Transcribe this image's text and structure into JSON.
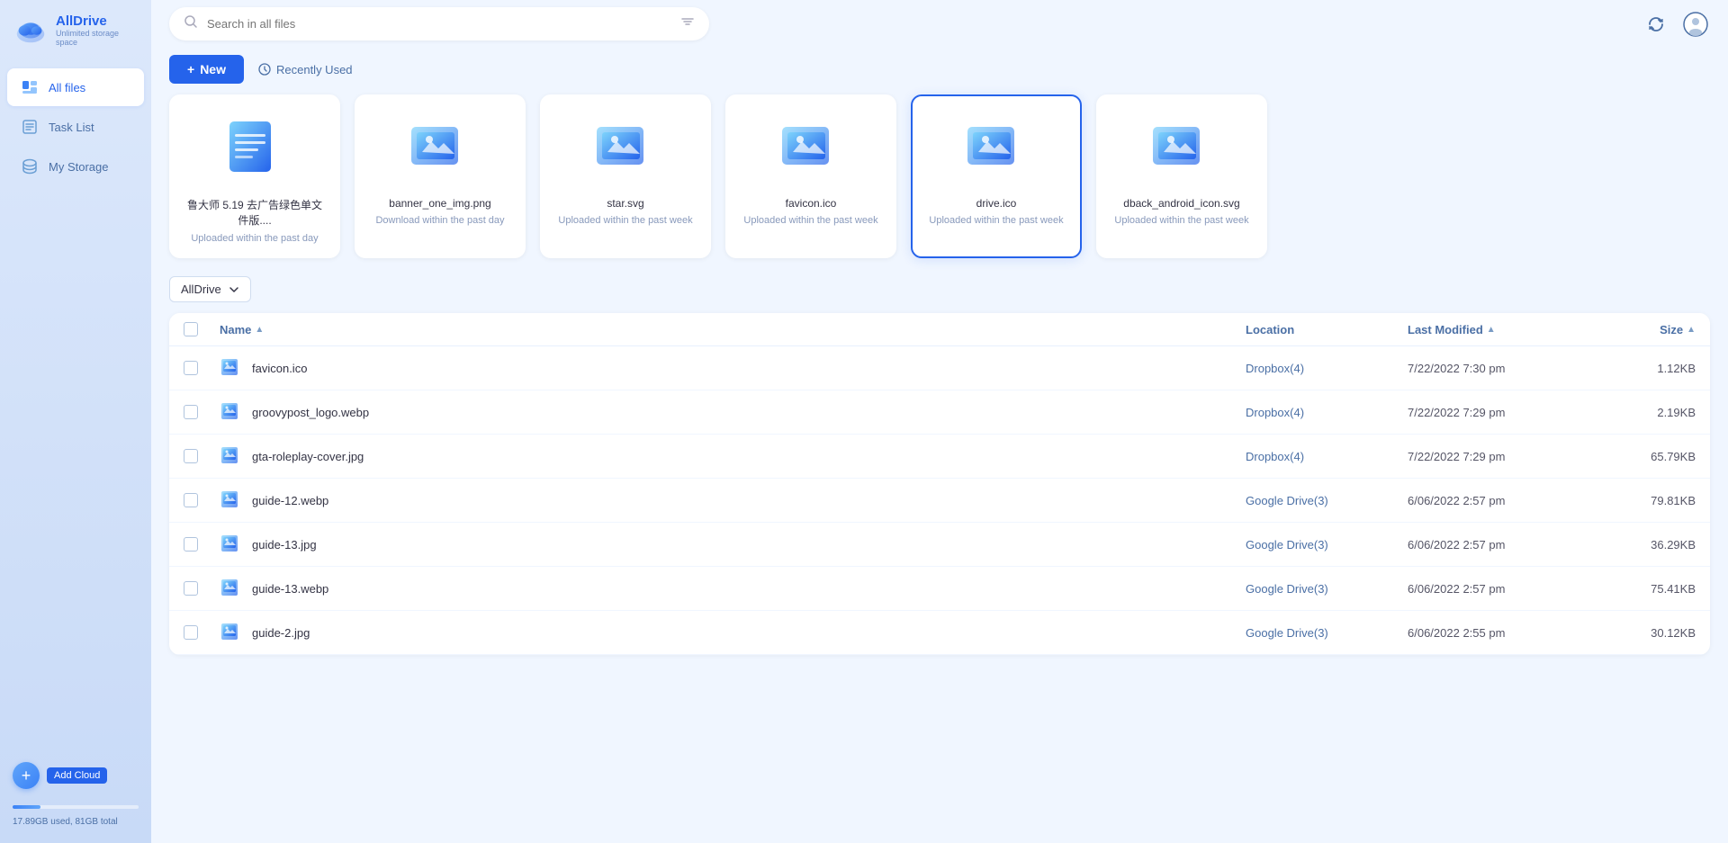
{
  "app": {
    "name": "AllDrive",
    "tagline": "Unlimited storage space"
  },
  "sidebar": {
    "nav_items": [
      {
        "id": "all-files",
        "label": "All files",
        "active": true
      },
      {
        "id": "task-list",
        "label": "Task List",
        "active": false
      },
      {
        "id": "my-storage",
        "label": "My Storage",
        "active": false
      }
    ],
    "add_cloud_label": "Add Cloud",
    "storage_text": "17.89GB used, 81GB total",
    "storage_percent": 22
  },
  "topbar": {
    "search_placeholder": "Search in all files"
  },
  "toolbar": {
    "new_label": "New",
    "recently_used_label": "Recently Used"
  },
  "recent_files": [
    {
      "name": "鲁大师 5.19 去广告绿色单文件版....",
      "date": "Uploaded within the past day",
      "type": "doc",
      "selected": false
    },
    {
      "name": "banner_one_img.png",
      "date": "Download within the past day",
      "type": "img",
      "selected": false
    },
    {
      "name": "star.svg",
      "date": "Uploaded within the past week",
      "type": "img",
      "selected": false
    },
    {
      "name": "favicon.ico",
      "date": "Uploaded within the past week",
      "type": "img",
      "selected": false
    },
    {
      "name": "drive.ico",
      "date": "Uploaded within the past week",
      "type": "img",
      "selected": true
    },
    {
      "name": "dback_android_icon.svg",
      "date": "Uploaded within the past week",
      "type": "img",
      "selected": false
    }
  ],
  "filter": {
    "label": "AllDrive"
  },
  "table": {
    "headers": {
      "name": "Name",
      "location": "Location",
      "last_modified": "Last Modified",
      "size": "Size"
    },
    "rows": [
      {
        "name": "favicon.ico",
        "location": "Dropbox(4)",
        "modified": "7/22/2022 7:30 pm",
        "size": "1.12KB"
      },
      {
        "name": "groovypost_logo.webp",
        "location": "Dropbox(4)",
        "modified": "7/22/2022 7:29 pm",
        "size": "2.19KB"
      },
      {
        "name": "gta-roleplay-cover.jpg",
        "location": "Dropbox(4)",
        "modified": "7/22/2022 7:29 pm",
        "size": "65.79KB"
      },
      {
        "name": "guide-12.webp",
        "location": "Google Drive(3)",
        "modified": "6/06/2022 2:57 pm",
        "size": "79.81KB"
      },
      {
        "name": "guide-13.jpg",
        "location": "Google Drive(3)",
        "modified": "6/06/2022 2:57 pm",
        "size": "36.29KB"
      },
      {
        "name": "guide-13.webp",
        "location": "Google Drive(3)",
        "modified": "6/06/2022 2:57 pm",
        "size": "75.41KB"
      },
      {
        "name": "guide-2.jpg",
        "location": "Google Drive(3)",
        "modified": "6/06/2022 2:55 pm",
        "size": "30.12KB"
      }
    ]
  }
}
